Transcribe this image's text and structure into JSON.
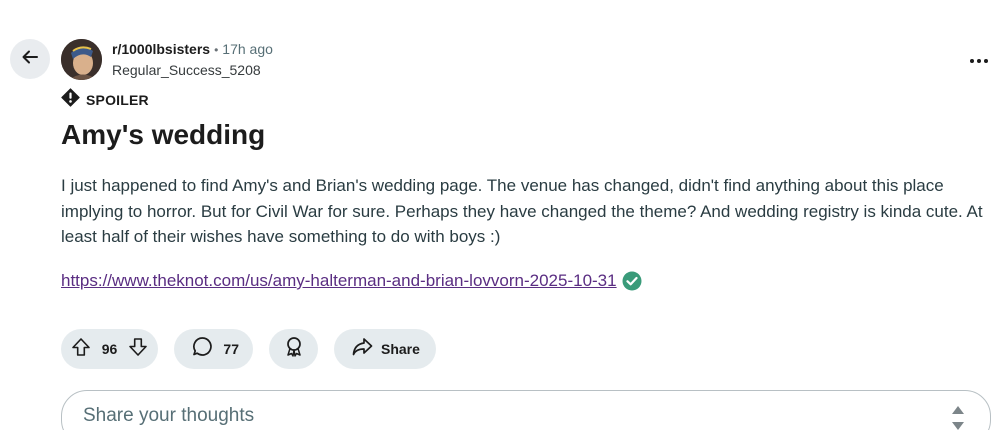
{
  "post": {
    "subreddit": "r/1000lbsisters",
    "separator": "•",
    "time": "17h ago",
    "author": "Regular_Success_5208",
    "spoiler_label": "SPOILER",
    "title": "Amy's wedding",
    "body": "I just happened to find Amy's and Brian's wedding page. The venue has changed, didn't find anything about this place implying to horror. But for Civil War for sure. Perhaps they have changed the theme? And wedding registry is kinda cute. At least half of their wishes have something to do with boys :)",
    "link": "https://www.theknot.com/us/amy-halterman-and-brian-lovvorn-2025-10-31"
  },
  "actions": {
    "vote_count": "96",
    "comment_count": "77",
    "share_label": "Share"
  },
  "comment_box": {
    "placeholder": "Share your thoughts"
  },
  "icons": {
    "back": "arrow-left-icon",
    "more": "more-horizontal-icon",
    "spoiler": "exclamation-diamond-icon",
    "verified": "check-circle-icon",
    "upvote": "arrow-up-icon",
    "downvote": "arrow-down-icon",
    "comment": "speech-bubble-icon",
    "award": "award-ribbon-icon",
    "share": "share-arrow-icon",
    "sort": "sort-arrows-icon"
  },
  "colors": {
    "pill_background": "#e5ebee",
    "link": "#5a2d82",
    "verified": "#3a9b7a"
  }
}
